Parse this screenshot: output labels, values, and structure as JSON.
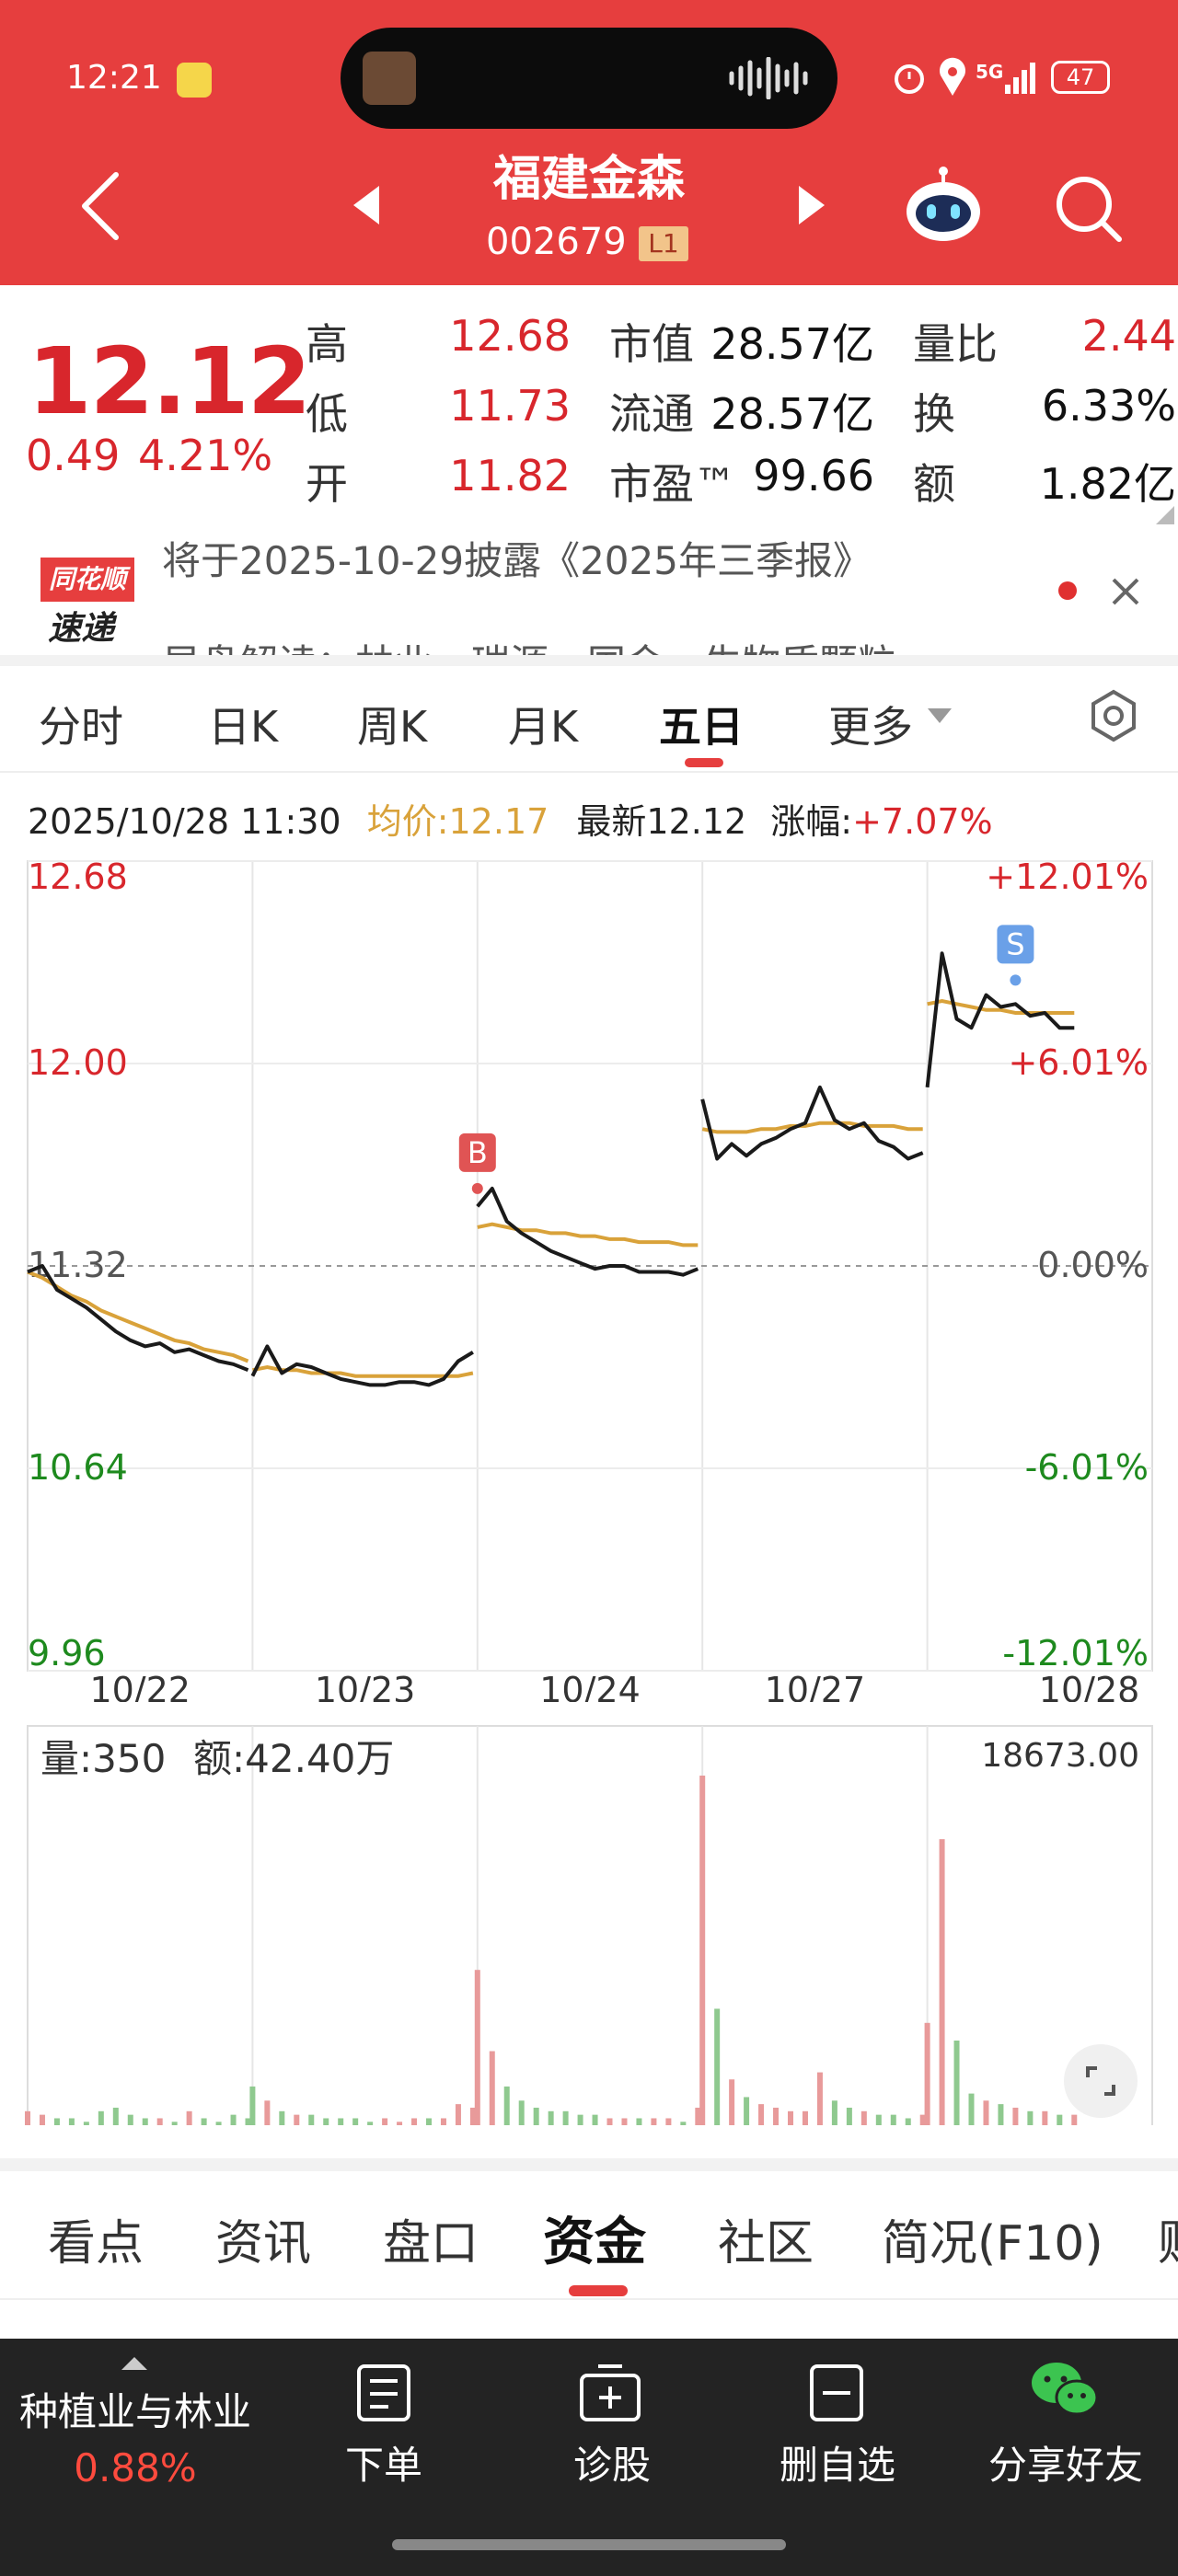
{
  "status_bar": {
    "time": "12:21",
    "signal": "5G",
    "battery": "47"
  },
  "header": {
    "stock_name": "福建金森",
    "stock_code": "002679",
    "level_badge": "L1",
    "icons": [
      "back-icon",
      "prev-stock-icon",
      "next-stock-icon",
      "robot-assistant-icon",
      "search-icon"
    ]
  },
  "quote": {
    "price": "12.12",
    "change": "0.49",
    "change_pct": "4.21%",
    "high_label": "高",
    "high": "12.68",
    "low_label": "低",
    "low": "11.73",
    "open_label": "开",
    "open": "11.82",
    "mcap_label": "市值",
    "mcap": "28.57亿",
    "float_label": "流通",
    "float": "28.57亿",
    "pe_label": "市盈™",
    "pe": "99.66",
    "volratio_label": "量比",
    "volratio": "2.44",
    "turnover_label": "换",
    "turnover": "6.33%",
    "amount_label": "额",
    "amount": "1.82亿"
  },
  "notice": {
    "brand_top": "同花顺",
    "brand_bottom": "速递",
    "line1": "将于2025-10-29披露《2025年三季报》",
    "line2": "早盘解读：林业、瑞源、国金、生物质颗粒"
  },
  "period_tabs": [
    "分时",
    "日K",
    "周K",
    "月K",
    "五日",
    "更多"
  ],
  "active_period": "五日",
  "chart_info": {
    "datetime": "2025/10/28 11:30",
    "avg_label": "均价:12.17",
    "latest_label": "最新12.12",
    "change_label": "涨幅:",
    "change_value": "+7.07%"
  },
  "chart_data": {
    "type": "line",
    "title": "",
    "x_dates": [
      "10/22",
      "10/23",
      "10/24",
      "10/27",
      "10/28"
    ],
    "prev_close": 11.32,
    "y_ticks": [
      "12.68",
      "12.00",
      "11.32",
      "10.64",
      "9.96"
    ],
    "pct_ticks": [
      "+12.01%",
      "+6.01%",
      "0.00%",
      "-6.01%",
      "-12.01%"
    ],
    "ylim": [
      9.96,
      12.68
    ],
    "series": [
      {
        "values": [
          11.3,
          11.32,
          11.24,
          11.21,
          11.18,
          11.14,
          11.1,
          11.07,
          11.05,
          11.06,
          11.03,
          11.04,
          11.02,
          11.0,
          10.99,
          10.97,
          10.95,
          11.05,
          10.96,
          10.99,
          10.98,
          10.96,
          10.94,
          10.93,
          10.92,
          10.92,
          10.93,
          10.93,
          10.92,
          10.94,
          11.0,
          11.03,
          11.52,
          11.58,
          11.47,
          11.43,
          11.4,
          11.37,
          11.35,
          11.33,
          11.31,
          11.32,
          11.32,
          11.3,
          11.3,
          11.3,
          11.29,
          11.31,
          11.88,
          11.68,
          11.73,
          11.69,
          11.73,
          11.75,
          11.78,
          11.8,
          11.92,
          11.81,
          11.78,
          11.8,
          11.74,
          11.72,
          11.68,
          11.7,
          11.92,
          12.37,
          12.15,
          12.12,
          12.23,
          12.19,
          12.2,
          12.16,
          12.17,
          12.12,
          12.12
        ]
      },
      {
        "values": [
          11.3,
          11.28,
          11.25,
          11.22,
          11.2,
          11.17,
          11.15,
          11.13,
          11.11,
          11.09,
          11.07,
          11.06,
          11.04,
          11.03,
          11.02,
          11.0,
          10.97,
          10.98,
          10.97,
          10.97,
          10.96,
          10.96,
          10.96,
          10.95,
          10.95,
          10.95,
          10.95,
          10.95,
          10.95,
          10.95,
          10.95,
          10.96,
          11.45,
          11.46,
          11.45,
          11.44,
          11.44,
          11.43,
          11.43,
          11.42,
          11.42,
          11.41,
          11.41,
          11.4,
          11.4,
          11.4,
          11.39,
          11.39,
          11.78,
          11.77,
          11.77,
          11.77,
          11.78,
          11.78,
          11.79,
          11.79,
          11.8,
          11.8,
          11.8,
          11.79,
          11.79,
          11.79,
          11.78,
          11.78,
          12.2,
          12.21,
          12.2,
          12.19,
          12.18,
          12.18,
          12.17,
          12.17,
          12.17,
          12.17,
          12.17
        ]
      }
    ],
    "markers": [
      {
        "label": "B",
        "day": 2,
        "price": 11.58
      },
      {
        "label": "S",
        "day": 4,
        "price": 12.28
      }
    ],
    "volume": {
      "max_label": "18673.00",
      "vol_label": "量:350",
      "amt_label": "额:42.40万",
      "values": [
        0.05,
        0.04,
        0.03,
        0.03,
        0.02,
        0.05,
        0.06,
        0.04,
        0.03,
        0.03,
        0.02,
        0.05,
        0.03,
        0.02,
        0.04,
        0.03,
        0.12,
        0.08,
        0.05,
        0.04,
        0.04,
        0.03,
        0.03,
        0.03,
        0.02,
        0.03,
        0.02,
        0.03,
        0.03,
        0.03,
        0.07,
        0.06,
        0.45,
        0.22,
        0.12,
        0.08,
        0.06,
        0.05,
        0.05,
        0.04,
        0.04,
        0.03,
        0.03,
        0.03,
        0.03,
        0.03,
        0.02,
        0.06,
        1.0,
        0.34,
        0.14,
        0.09,
        0.07,
        0.06,
        0.05,
        0.05,
        0.16,
        0.08,
        0.06,
        0.05,
        0.04,
        0.04,
        0.03,
        0.04,
        0.3,
        0.82,
        0.25,
        0.1,
        0.08,
        0.07,
        0.06,
        0.05,
        0.05,
        0.04,
        0.04
      ]
    }
  },
  "bottom_tabs": [
    "看点",
    "资讯",
    "盘口",
    "资金",
    "社区",
    "简况(F10)",
    "财务"
  ],
  "active_bottom_tab": "资金",
  "toolbar": {
    "sector_name": "种植业与林业",
    "sector_change": "0.88%",
    "order": "下单",
    "diagnose": "诊股",
    "remove_watch": "删自选",
    "share": "分享好友"
  },
  "colors": {
    "header_red": "#e63e3e",
    "rise_red": "#d8262c",
    "fall_green": "#1e8a1e",
    "avg_gold": "#d9a23a",
    "toolbar_bg": "#232323"
  }
}
